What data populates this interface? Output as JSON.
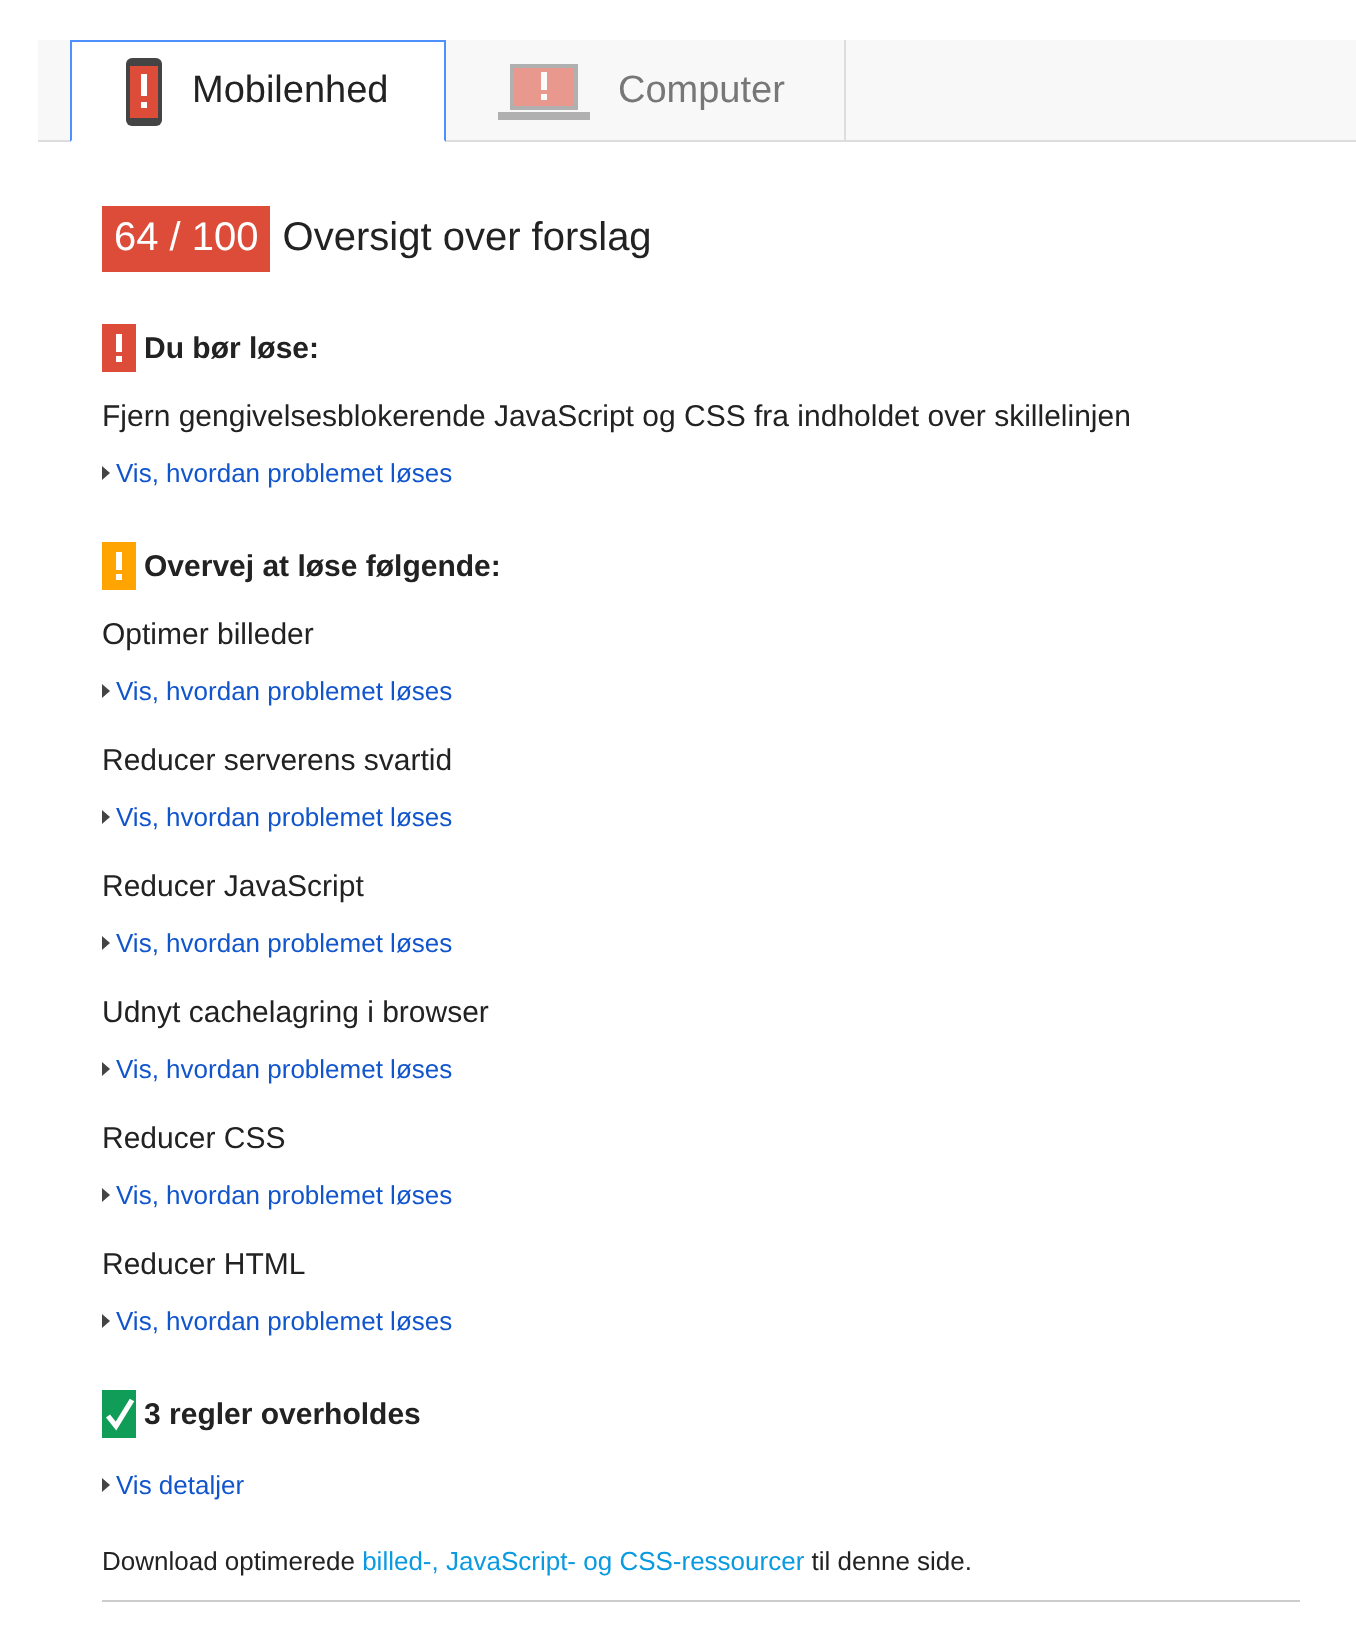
{
  "tabs": [
    {
      "label": "Mobilenhed",
      "kind": "mobile",
      "selected": true
    },
    {
      "label": "Computer",
      "kind": "desktop",
      "selected": false
    }
  ],
  "score": "64 / 100",
  "summary_title": "Oversigt over forslag",
  "sections": [
    {
      "kind": "error",
      "heading": "Du bør løse:",
      "items": [
        {
          "title": "Fjern gengivelsesblokerende JavaScript og CSS fra indholdet over skillelinjen",
          "link": "Vis, hvordan problemet løses"
        }
      ]
    },
    {
      "kind": "warning",
      "heading": "Overvej at løse følgende:",
      "items": [
        {
          "title": "Optimer billeder",
          "link": "Vis, hvordan problemet løses"
        },
        {
          "title": "Reducer serverens svartid",
          "link": "Vis, hvordan problemet løses"
        },
        {
          "title": "Reducer JavaScript",
          "link": "Vis, hvordan problemet løses"
        },
        {
          "title": "Udnyt cachelagring i browser",
          "link": "Vis, hvordan problemet løses"
        },
        {
          "title": "Reducer CSS",
          "link": "Vis, hvordan problemet løses"
        },
        {
          "title": "Reducer HTML",
          "link": "Vis, hvordan problemet løses"
        }
      ]
    },
    {
      "kind": "pass",
      "heading": "3 regler overholdes",
      "items": [
        {
          "link": "Vis detaljer"
        }
      ]
    }
  ],
  "footer": {
    "before": "Download optimerede",
    "link": "billed-, JavaScript- og CSS-ressourcer",
    "after": "til denne side."
  }
}
